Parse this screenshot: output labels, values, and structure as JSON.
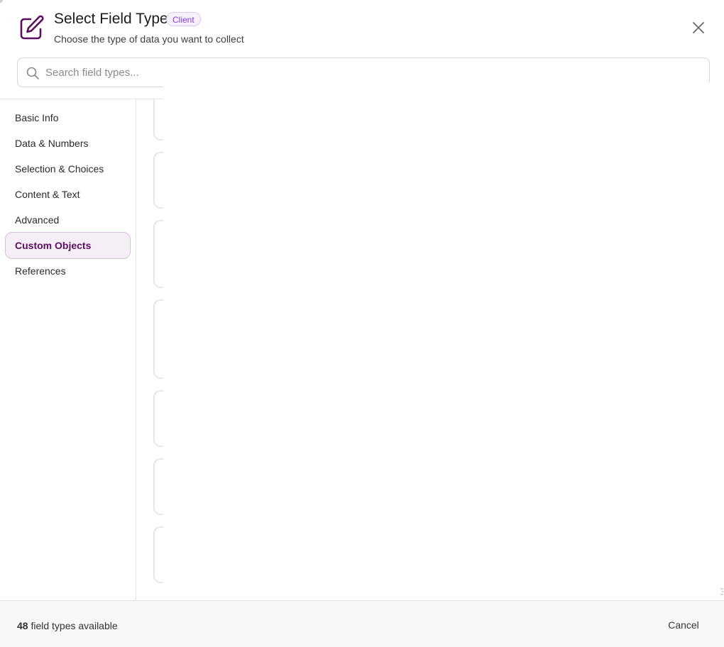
{
  "header": {
    "title": "Select Field Type",
    "badge": "Client",
    "subtitle": "Choose the type of data you want to collect",
    "icon": "edit-icon",
    "close_icon": "close-icon"
  },
  "search": {
    "placeholder": "Search field types...",
    "value": "",
    "icon": "search-icon"
  },
  "sidebar": {
    "items": [
      {
        "label": "Basic Info",
        "active": false
      },
      {
        "label": "Data & Numbers",
        "active": false
      },
      {
        "label": "Selection & Choices",
        "active": false
      },
      {
        "label": "Content & Text",
        "active": false
      },
      {
        "label": "Advanced",
        "active": false
      },
      {
        "label": "Custom Objects",
        "active": true
      },
      {
        "label": "References",
        "active": false
      }
    ]
  },
  "footer": {
    "count": "48",
    "count_suffix": " field types available",
    "cancel_label": "Cancel"
  },
  "colors": {
    "accent": "#5b0f5f",
    "active_bg": "#f5eef7",
    "badge_text": "#8a3fd1",
    "border": "#e4e4e4"
  }
}
